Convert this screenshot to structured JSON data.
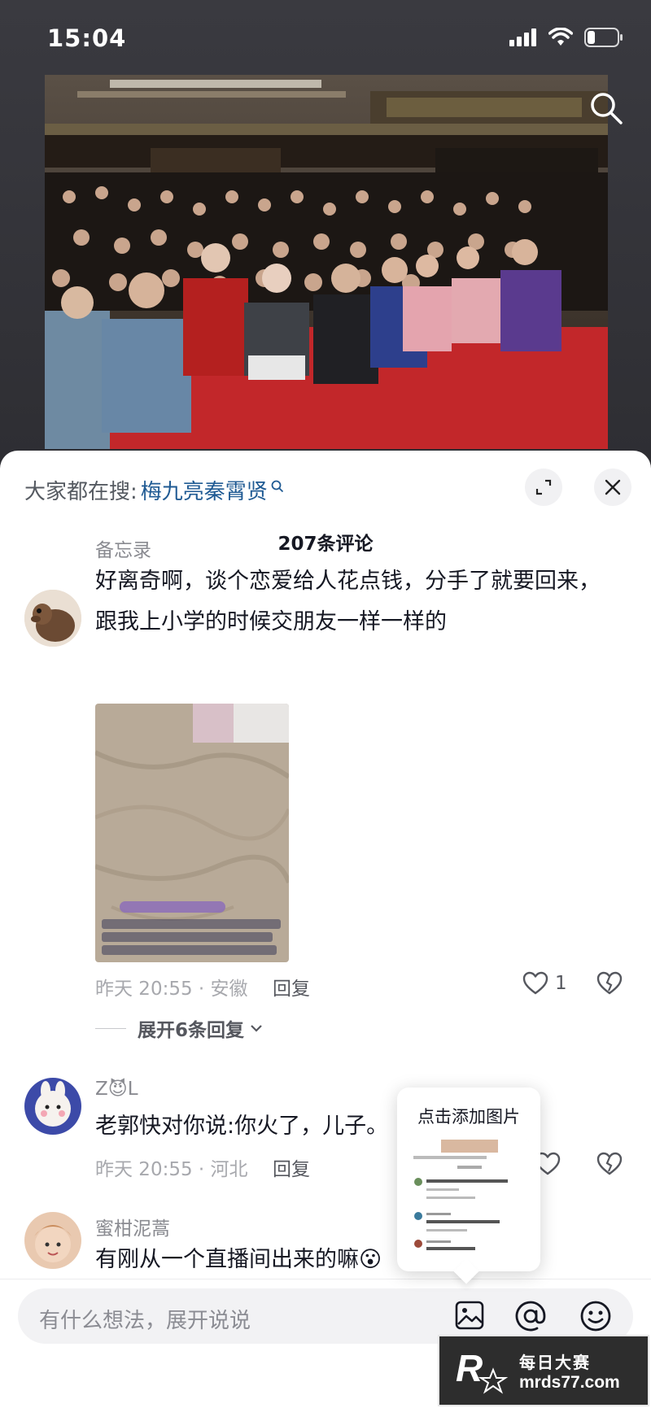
{
  "status_bar": {
    "time": "15:04"
  },
  "sheet": {
    "hot_search_label": "大家都在搜:",
    "hot_search_keyword": "梅九亮秦霄贤",
    "comment_count": "207条评论"
  },
  "comments": [
    {
      "username": "备忘录",
      "text_line1": "好离奇啊，谈个恋爱给人花点钱，分手了就要回来，",
      "text_line2": "跟我上小学的时候交朋友一样一样的",
      "meta": "昨天 20:55 · 安徽",
      "reply_label": "回复",
      "likes": "1",
      "expand_replies": "展开6条回复"
    },
    {
      "username": "Z😈L",
      "text": "老郭快对你说:你火了，儿子。",
      "meta": "昨天 20:55 · 河北",
      "reply_label": "回复"
    },
    {
      "username": "蜜柑泥蒿",
      "text": "有刚从一个直播间出来的嘛😮"
    }
  ],
  "popup": {
    "title": "点击添加图片"
  },
  "input_bar": {
    "placeholder": "有什么想法，展开说说"
  },
  "watermark": {
    "line1": "每日大赛",
    "line2": "mrds77.com"
  },
  "icons": {
    "search": "search-icon",
    "expand": "expand-icon",
    "close": "close-icon",
    "heart": "heart-icon",
    "dislike": "broken-heart-icon",
    "image": "image-icon",
    "at": "at-icon",
    "emoji": "emoji-icon"
  }
}
